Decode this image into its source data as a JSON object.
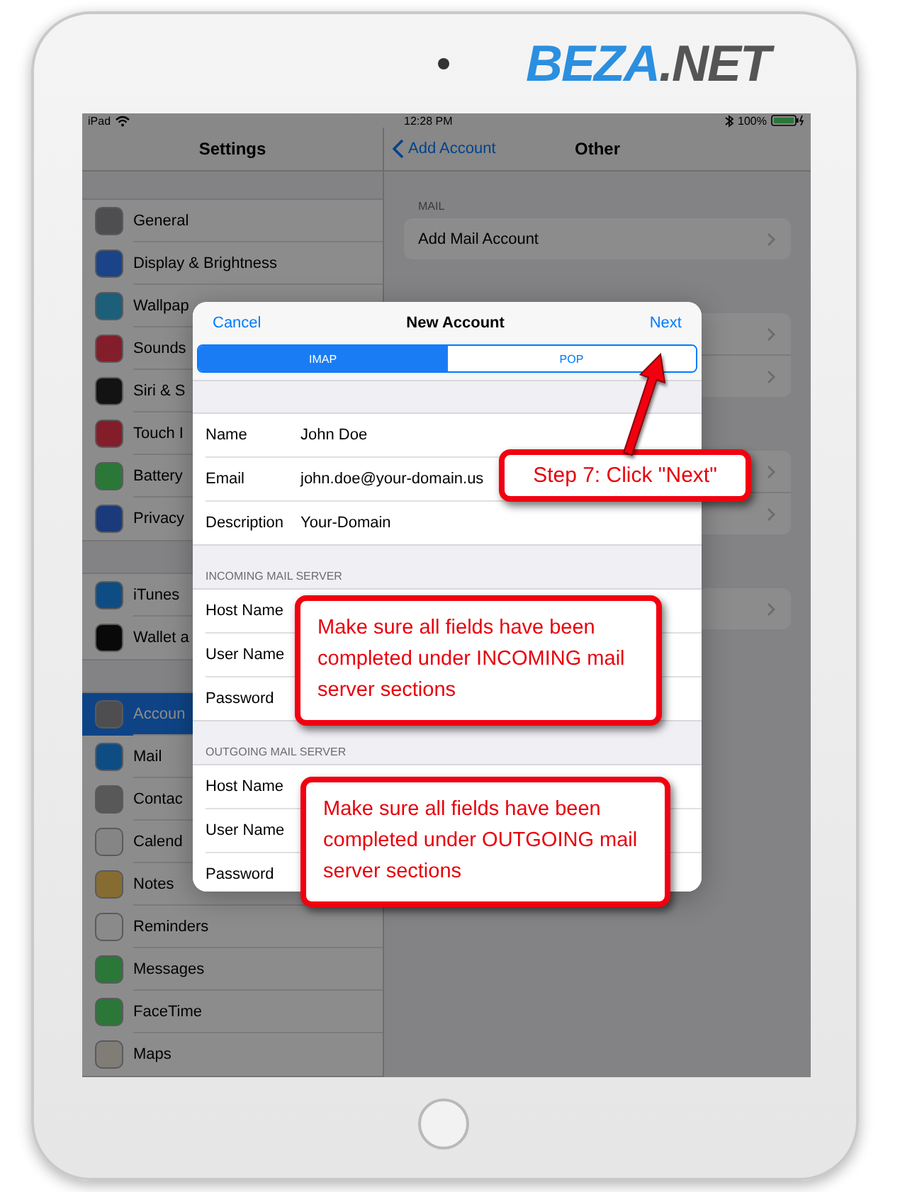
{
  "device": {
    "logo": {
      "primary": "BEZA",
      "secondary": ".NET"
    }
  },
  "status_bar": {
    "carrier": "iPad",
    "time": "12:28 PM",
    "battery": "100%"
  },
  "sidebar": {
    "title": "Settings",
    "groups": [
      [
        {
          "label": "General",
          "selected": false,
          "color": "#4e4e51"
        },
        {
          "label": "Display & Brightness",
          "selected": false,
          "color": "#1a4487"
        },
        {
          "label": "Wallpap",
          "selected": false,
          "color": "#1d5e79"
        },
        {
          "label": "Sounds",
          "selected": false,
          "color": "#841d2a"
        },
        {
          "label": "Siri & S",
          "selected": false,
          "color": "#131313"
        },
        {
          "label": "Touch I",
          "selected": false,
          "color": "#841d2a"
        },
        {
          "label": "Battery",
          "selected": false,
          "color": "#2a7737"
        },
        {
          "label": "Privacy",
          "selected": false,
          "color": "#1a3a7b"
        }
      ],
      [
        {
          "label": "iTunes",
          "selected": false,
          "color": "#0e4d84"
        },
        {
          "label": "Wallet a",
          "selected": false,
          "color": "#090909"
        }
      ],
      [
        {
          "label": "Accoun",
          "selected": true,
          "color": "#4e4e51"
        },
        {
          "label": "Mail",
          "selected": false,
          "color": "#0e4d84"
        },
        {
          "label": "Contac",
          "selected": false,
          "color": "#585858"
        },
        {
          "label": "Calend",
          "selected": false,
          "color": "#858585"
        },
        {
          "label": "Notes",
          "selected": false,
          "color": "#876c32"
        },
        {
          "label": "Reminders",
          "selected": false,
          "color": "#8a8a8a"
        },
        {
          "label": "Messages",
          "selected": false,
          "color": "#2a7737"
        },
        {
          "label": "FaceTime",
          "selected": false,
          "color": "#2a7737"
        },
        {
          "label": "Maps",
          "selected": false,
          "color": "#807d77"
        }
      ]
    ]
  },
  "detail": {
    "back": "Add Account",
    "title": "Other",
    "header": "MAIL",
    "row": "Add Mail Account"
  },
  "dialog": {
    "cancel": "Cancel",
    "title": "New Account",
    "next": "Next",
    "segments": [
      {
        "label": "IMAP",
        "selected": true
      },
      {
        "label": "POP",
        "selected": false
      }
    ],
    "fields": [
      {
        "label": "Name",
        "value": "John Doe"
      },
      {
        "label": "Email",
        "value": "john.doe@your-domain.us"
      },
      {
        "label": "Description",
        "value": "Your-Domain"
      }
    ],
    "sections": [
      {
        "header": "INCOMING MAIL SERVER",
        "fields": [
          "Host Name",
          "User Name",
          "Password"
        ]
      },
      {
        "header": "OUTGOING MAIL SERVER",
        "fields": [
          "Host Name",
          "User Name",
          "Password"
        ]
      }
    ]
  },
  "callouts": [
    {
      "kind": "step",
      "text": "Step 7: Click \"Next\""
    },
    {
      "kind": "note",
      "text": "Make sure all fields have been completed under INCOMING mail server sections"
    },
    {
      "kind": "note",
      "text": "Make sure all fields have been completed under OUTGOING mail server sections"
    }
  ]
}
